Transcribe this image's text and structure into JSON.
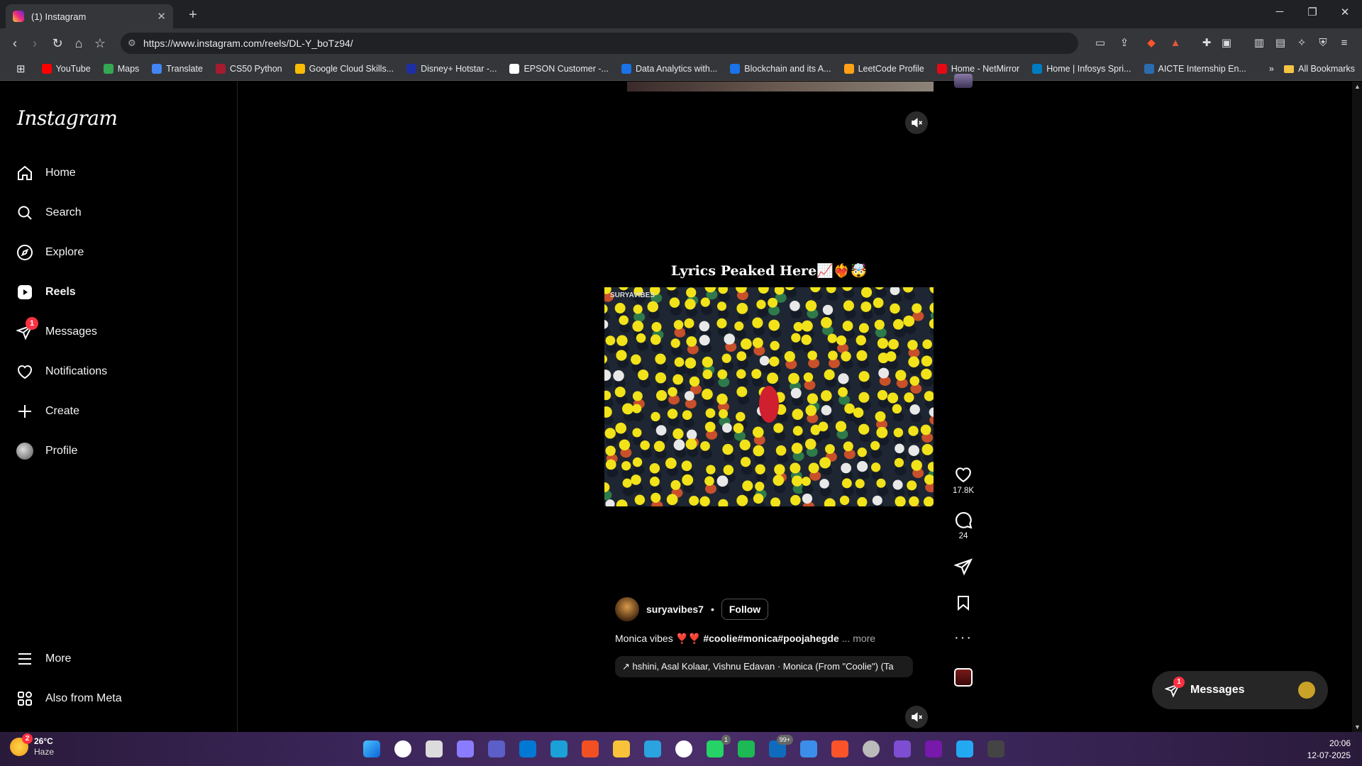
{
  "browser": {
    "tab_title": "(1) Instagram",
    "url": "https://www.instagram.com/reels/DL-Y_boTz94/",
    "bookmarks": [
      {
        "label": "YouTube",
        "color": "#ff0000"
      },
      {
        "label": "Maps",
        "color": "#34a853"
      },
      {
        "label": "Translate",
        "color": "#4285f4"
      },
      {
        "label": "CS50 Python",
        "color": "#a51c30"
      },
      {
        "label": "Google Cloud Skills...",
        "color": "#fbbc05"
      },
      {
        "label": "Disney+ Hotstar -...",
        "color": "#1f2fa3"
      },
      {
        "label": "EPSON Customer -...",
        "color": "#ffffff"
      },
      {
        "label": "Data Analytics with...",
        "color": "#1a73e8"
      },
      {
        "label": "Blockchain and its A...",
        "color": "#1a73e8"
      },
      {
        "label": "LeetCode Profile",
        "color": "#ffa116"
      },
      {
        "label": "Home - NetMirror",
        "color": "#e50914"
      },
      {
        "label": "Home | Infosys Spri...",
        "color": "#007cc3"
      },
      {
        "label": "AICTE Internship En...",
        "color": "#2b6cb0"
      }
    ],
    "all_bookmarks": "All Bookmarks"
  },
  "brand": {
    "logo": "Instagram"
  },
  "nav": [
    {
      "label": "Home",
      "icon": "home-icon"
    },
    {
      "label": "Search",
      "icon": "search-icon"
    },
    {
      "label": "Explore",
      "icon": "compass-icon"
    },
    {
      "label": "Reels",
      "icon": "reels-icon",
      "active": true
    },
    {
      "label": "Messages",
      "icon": "messenger-icon",
      "badge": "1"
    },
    {
      "label": "Notifications",
      "icon": "heart-icon"
    },
    {
      "label": "Create",
      "icon": "plus-icon"
    },
    {
      "label": "Profile",
      "icon": "avatar"
    }
  ],
  "nav_bottom": [
    {
      "label": "More",
      "icon": "menu-icon"
    },
    {
      "label": "Also from Meta",
      "icon": "meta-icon"
    }
  ],
  "reel": {
    "overlay_title": "Lyrics Peaked Here📈❤️‍🔥🤯",
    "watermark": "SURYAVIBES",
    "username": "suryavibes7",
    "separator": "•",
    "follow_label": "Follow",
    "caption_text": "Monica vibes ❣️❣️ ",
    "caption_tags": "#coolie#monica#poojahegde",
    "caption_more": " ... more",
    "audio_arrow": "↗",
    "audio_text": "hshini, Asal Kolaar, Vishnu Edavan · Monica (From \"Coolie\") (Ta",
    "likes": "17.8K",
    "comments": "24"
  },
  "messages_pill": {
    "label": "Messages",
    "badge": "1"
  },
  "taskbar": {
    "temperature": "26°C",
    "condition": "Haze",
    "weather_badge": "2",
    "time": "20:06",
    "date": "12-07-2025",
    "apps": [
      {
        "name": "start",
        "color": "#3aa0ff"
      },
      {
        "name": "search",
        "color": "#ffffff"
      },
      {
        "name": "task-view",
        "color": "#dcdcdc"
      },
      {
        "name": "copilot",
        "color": "#8a7cff"
      },
      {
        "name": "teams",
        "color": "#5b5fc7"
      },
      {
        "name": "store",
        "color": "#0078d4"
      },
      {
        "name": "edge",
        "color": "#1ba0d8"
      },
      {
        "name": "ms-store",
        "color": "#f25022"
      },
      {
        "name": "file-explorer",
        "color": "#f8c33a"
      },
      {
        "name": "telegram",
        "color": "#2aa3df"
      },
      {
        "name": "media-player",
        "color": "#ffffff"
      },
      {
        "name": "whatsapp",
        "color": "#25d366",
        "badge": "1"
      },
      {
        "name": "spotify",
        "color": "#1db954"
      },
      {
        "name": "outlook",
        "color": "#0f6cbd",
        "badge": "99+"
      },
      {
        "name": "todo",
        "color": "#3b8eea"
      },
      {
        "name": "brave",
        "color": "#fb542b"
      },
      {
        "name": "clock",
        "color": "#bbbbbb"
      },
      {
        "name": "affinity",
        "color": "#7e4dd2"
      },
      {
        "name": "onenote",
        "color": "#7719aa"
      },
      {
        "name": "vscode",
        "color": "#23a9f2"
      },
      {
        "name": "terminal",
        "color": "#444444"
      }
    ]
  }
}
